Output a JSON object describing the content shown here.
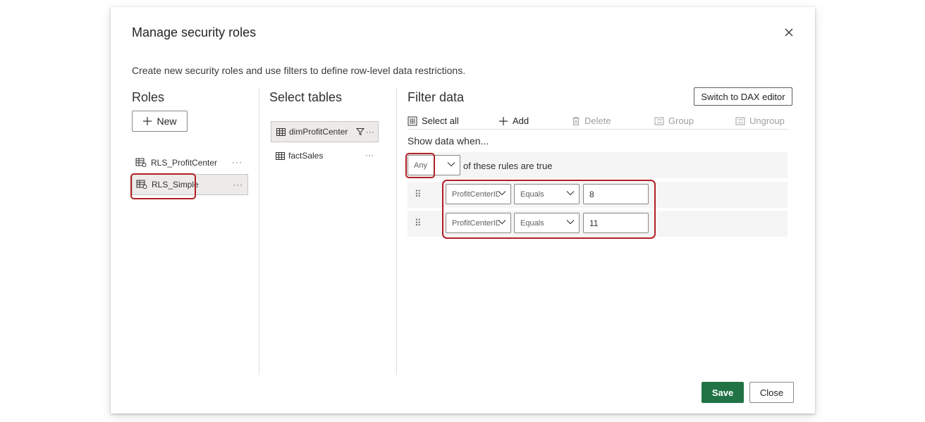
{
  "dialog": {
    "title": "Manage security roles",
    "subtitle": "Create new security roles and use filters to define row-level data restrictions."
  },
  "roles": {
    "heading": "Roles",
    "new_label": "New",
    "items": [
      {
        "label": "RLS_ProfitCenter",
        "selected": false
      },
      {
        "label": "RLS_Simple",
        "selected": true
      }
    ],
    "more": "···"
  },
  "tables": {
    "heading": "Select tables",
    "items": [
      {
        "label": "dimProfitCenter",
        "selected": true,
        "filtered": true
      },
      {
        "label": "factSales",
        "selected": false,
        "filtered": false
      }
    ],
    "more": "···"
  },
  "filter": {
    "heading": "Filter data",
    "dax_button": "Switch to DAX editor",
    "toolbar": {
      "select_all": "Select all",
      "add": "Add",
      "delete": "Delete",
      "group": "Group",
      "ungroup": "Ungroup"
    },
    "show_data_when": "Show data when...",
    "match_mode": "Any",
    "match_suffix": "of these rules are true",
    "rules": [
      {
        "column": "ProfitCenterID",
        "operator": "Equals",
        "value": "8"
      },
      {
        "column": "ProfitCenterID",
        "operator": "Equals",
        "value": "11"
      }
    ]
  },
  "footer": {
    "save": "Save",
    "close": "Close"
  },
  "colors": {
    "accent": "#217346",
    "highlight": "#b11f24"
  }
}
